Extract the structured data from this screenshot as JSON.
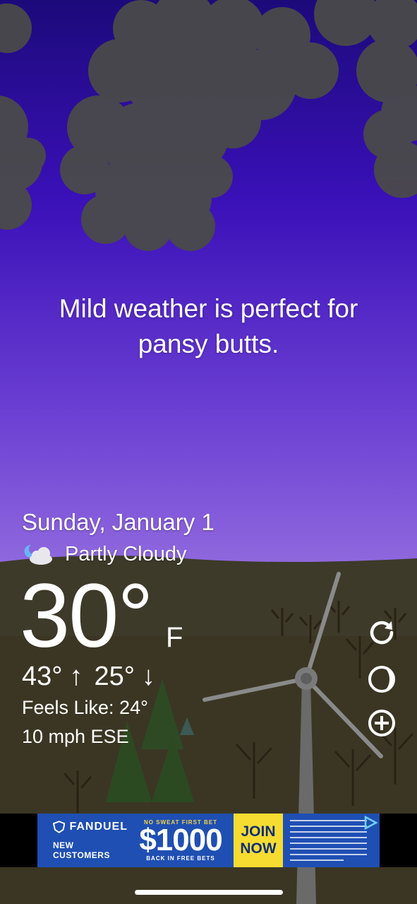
{
  "message": "Mild weather is perfect for pansy butts.",
  "date": "Sunday, January 1",
  "condition": {
    "icon": "moon-cloud-icon",
    "text": "Partly Cloudy"
  },
  "temperature": {
    "value": "30°",
    "unit": "F"
  },
  "hilo": {
    "high": "43°",
    "high_arrow": "↑",
    "low": "25°",
    "low_arrow": "↓"
  },
  "feels_like": "Feels Like: 24°",
  "wind": "10 mph ESE",
  "buttons": [
    "refresh-icon",
    "moon-phase-icon",
    "add-icon"
  ],
  "ad": {
    "brand": "FANDUEL",
    "tagline": "NEW CUSTOMERS",
    "top_small": "NO SWEAT FIRST BET",
    "amount": "$1000",
    "bottom_small": "BACK IN FREE BETS",
    "cta_line1": "JOIN",
    "cta_line2": "NOW",
    "choices_icon": "ad-choices-icon"
  },
  "colors": {
    "sky_top": "#1c0a7a",
    "sky_bottom": "#b9a1ea",
    "ground": "#3a3420",
    "ad_blue": "#1f4fb3",
    "ad_yellow": "#f6dc31"
  }
}
